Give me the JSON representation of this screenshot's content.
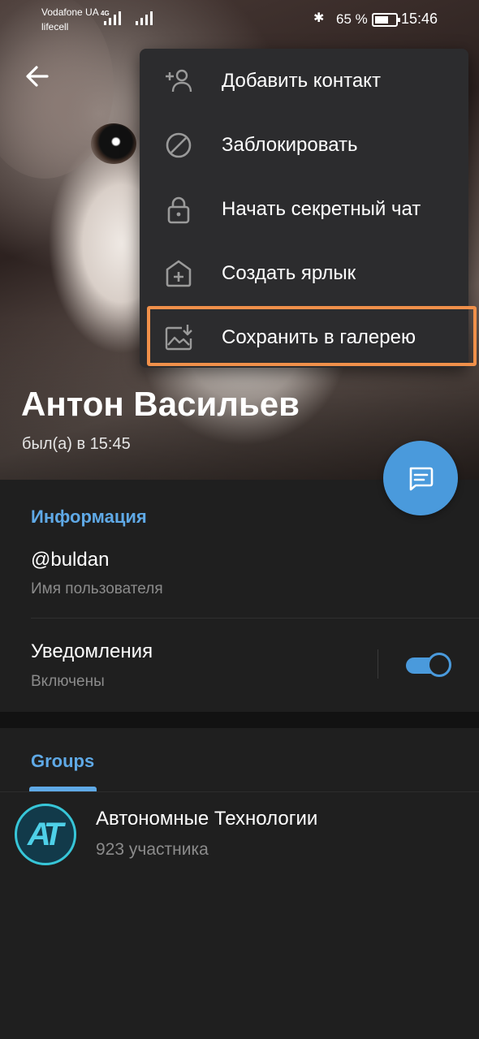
{
  "status_bar": {
    "carrier_1": "Vodafone UA",
    "carrier_2": "lifecell",
    "network": "4G",
    "battery_percent": "65 %",
    "battery_level": 0.65,
    "time": "15:46"
  },
  "profile": {
    "name": "Антон Васильев",
    "last_seen": "был(а) в 15:45"
  },
  "menu": {
    "items": [
      {
        "label": "Добавить контакт",
        "icon": "add-contact-icon"
      },
      {
        "label": "Заблокировать",
        "icon": "block-icon"
      },
      {
        "label": "Начать секретный чат",
        "icon": "lock-icon"
      },
      {
        "label": "Создать ярлык",
        "icon": "add-shortcut-icon"
      },
      {
        "label": "Сохранить в галерею",
        "icon": "save-to-gallery-icon"
      }
    ],
    "highlighted_index": 4,
    "highlight_color": "#f0904a"
  },
  "info": {
    "title": "Информация",
    "username": "@buldan",
    "username_caption": "Имя пользователя",
    "notifications_label": "Уведомления",
    "notifications_status": "Включены",
    "notifications_on": true
  },
  "groups": {
    "tab_label": "Groups",
    "items": [
      {
        "avatar_text": "AT",
        "title": "Автономные Технологии",
        "subtitle": "923 участника"
      }
    ]
  },
  "colors": {
    "accent": "#4a9adc",
    "section_title": "#5fa9e6",
    "background": "#1f1f1f"
  }
}
